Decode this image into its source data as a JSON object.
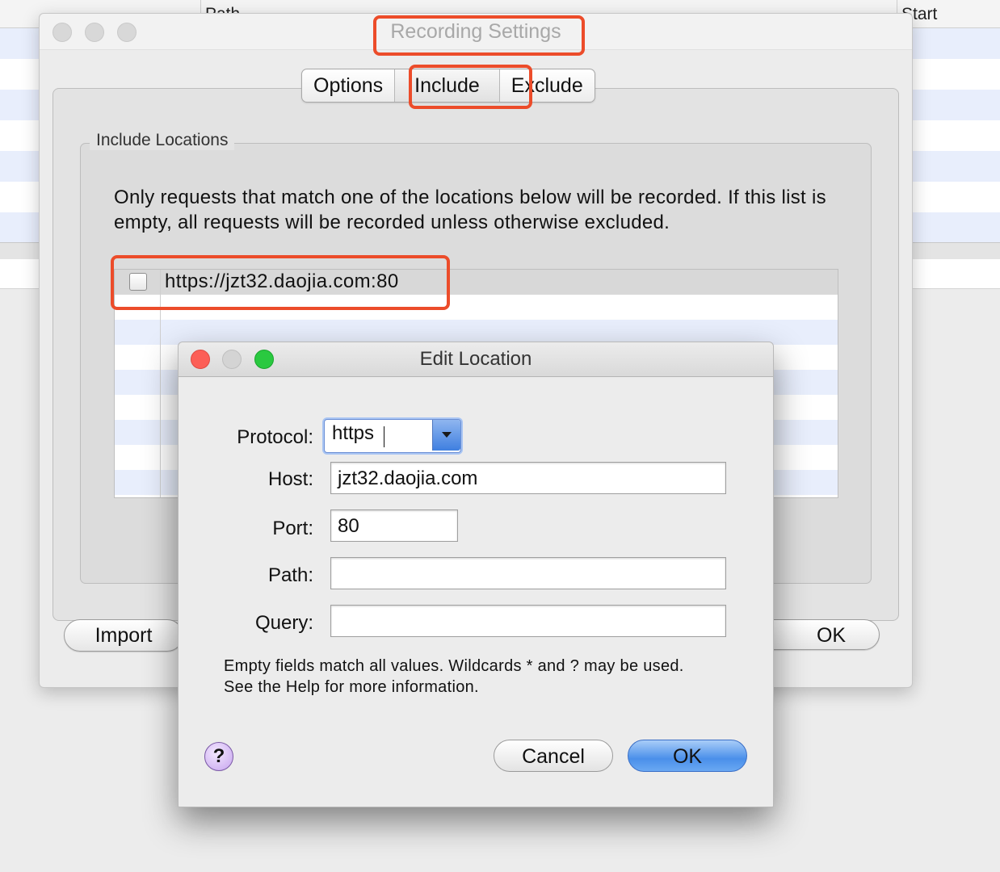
{
  "background_app": {
    "columns": [
      "Path",
      "Start"
    ]
  },
  "recording_settings": {
    "title": "Recording Settings",
    "tabs": [
      {
        "label": "Options",
        "active": false
      },
      {
        "label": "Include",
        "active": true
      },
      {
        "label": "Exclude",
        "active": false
      }
    ],
    "group_title": "Include Locations",
    "description": "Only requests that match one of the locations below will be recorded. If this list is empty, all requests will be recorded unless otherwise excluded.",
    "locations": [
      {
        "checked": false,
        "url": "https://jzt32.daojia.com:80"
      }
    ],
    "import_label": "Import",
    "ok_label": "OK"
  },
  "edit_location": {
    "title": "Edit Location",
    "protocol_label": "Protocol:",
    "protocol_value": "https",
    "host_label": "Host:",
    "host_value": "jzt32.daojia.com",
    "port_label": "Port:",
    "port_value": "80",
    "path_label": "Path:",
    "path_value": "",
    "query_label": "Query:",
    "query_value": "",
    "hint_line1": "Empty fields match all values. Wildcards * and ? may be used.",
    "hint_line2": "See the Help for more information.",
    "help_label": "?",
    "cancel_label": "Cancel",
    "ok_label": "OK"
  },
  "colors": {
    "highlight": "#ec4c2a",
    "selected_row": "#d8d8d8",
    "alt_row": "#e8eefc",
    "ok_button": "#4a8fea"
  },
  "icons": [
    "help-icon",
    "dropdown-arrow-icon",
    "close-icon",
    "minimize-icon",
    "zoom-icon"
  ]
}
